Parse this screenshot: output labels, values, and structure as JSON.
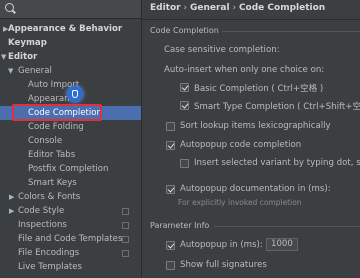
{
  "sidebar": {
    "items": [
      {
        "label": "Appearance & Behavior"
      },
      {
        "label": "Keymap"
      },
      {
        "label": "Editor"
      },
      {
        "label": "General"
      },
      {
        "label": "Auto Import"
      },
      {
        "label": "Appearance"
      },
      {
        "label": "Code Completion"
      },
      {
        "label": "Code Folding"
      },
      {
        "label": "Console"
      },
      {
        "label": "Editor Tabs"
      },
      {
        "label": "Postfix Completion"
      },
      {
        "label": "Smart Keys"
      },
      {
        "label": "Colors & Fonts"
      },
      {
        "label": "Code Style"
      },
      {
        "label": "Inspections"
      },
      {
        "label": "File and Code Templates"
      },
      {
        "label": "File Encodings"
      },
      {
        "label": "Live Templates"
      }
    ]
  },
  "breadcrumb": {
    "part1": "Editor",
    "sep1": "›",
    "part2": "General",
    "sep2": "›",
    "part3": "Code Completion"
  },
  "code_completion": {
    "section_title": "Code Completion",
    "case_sensitive": "Case sensitive completion:",
    "auto_insert": "Auto-insert when only one choice on:",
    "basic_completion": "Basic Completion ( Ctrl+空格 )",
    "smart_type_completion": "Smart Type Completion ( Ctrl+Shift+空格 )",
    "sort_lookup": "Sort lookup items lexicographically",
    "autopopup_code": "Autopopup code completion",
    "insert_selected": "Insert selected variant by typing dot, space",
    "autopopup_doc": "Autopopup documentation in (ms):",
    "autopopup_doc_hint": "For explicitly invoked completion"
  },
  "parameter_info": {
    "section_title": "Parameter Info",
    "autopopup_ms": "Autopopup in (ms):",
    "autopopup_ms_value": "1000",
    "show_full_signatures": "Show full signatures"
  }
}
